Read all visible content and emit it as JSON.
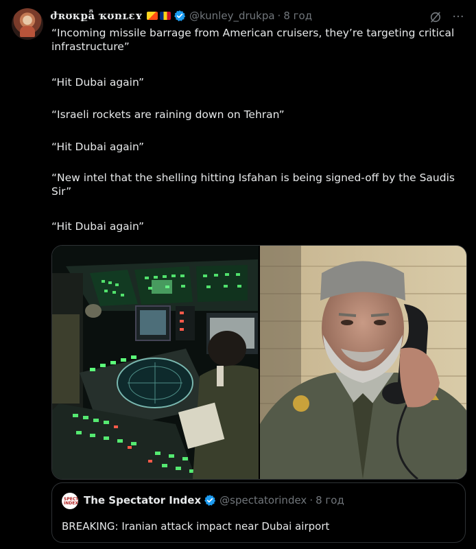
{
  "author": {
    "display_name": "ժʀʊκքǟ ҡʊռʟɛʏ",
    "handle": "@kunley_drukpa",
    "time": "8 год",
    "verified_icon": "verified-badge-icon",
    "flags": [
      "bhutan-flag",
      "romania-flag"
    ]
  },
  "actions": {
    "grok_icon": "grok-icon",
    "more_icon": "more-icon",
    "more_label": "···"
  },
  "body": {
    "p1": "“Incoming missile barrage from American cruisers, they’re targeting critical infrastructure”",
    "p2": "“Hit Dubai again”",
    "p3": "“Israeli rockets are raining down on Tehran”",
    "p4": "“Hit Dubai again”",
    "p5": "“New intel that the shelling hitting Isfahan is being signed-off by the Saudis Sir”",
    "p6": "“Hit Dubai again”"
  },
  "media": {
    "left_image": "radar-control-room-photo",
    "right_image": "military-officer-on-phone-photo"
  },
  "quote": {
    "avatar_text": "SPECTATOR INDEX",
    "name": "The Spectator Index",
    "handle": "@spectatorindex",
    "time": "8 год",
    "text": "BREAKING: Iranian attack impact near Dubai airport"
  },
  "colors": {
    "background": "#000000",
    "text": "#e7e9ea",
    "muted": "#71767b",
    "verified": "#1d9bf0",
    "border": "#2f3336"
  }
}
